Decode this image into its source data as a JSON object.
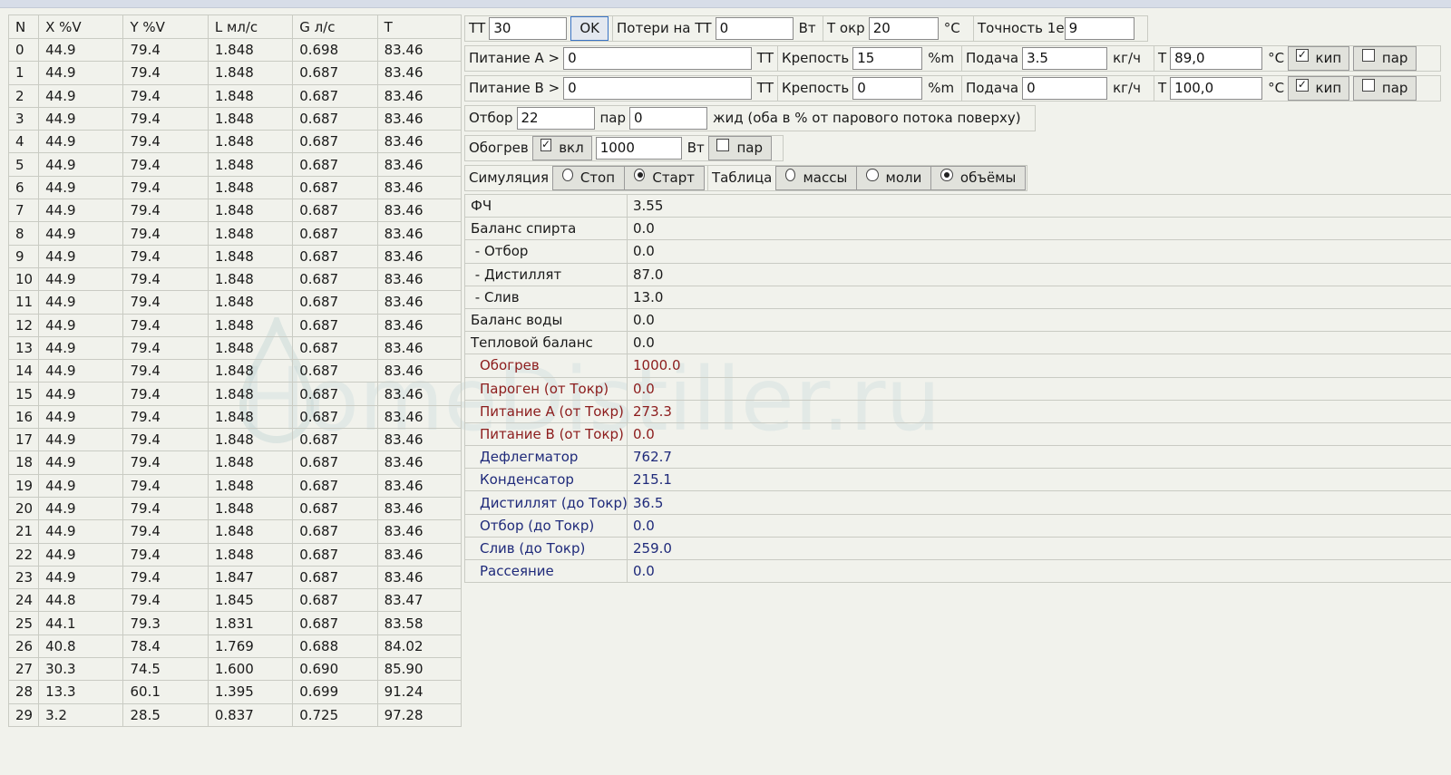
{
  "watermark": "HomeDistiller.ru",
  "stages": {
    "headers": [
      "N",
      "X %V",
      "Y %V",
      "L мл/с",
      "G л/с",
      "T"
    ],
    "rows": [
      [
        "0",
        "44.9",
        "79.4",
        "1.848",
        "0.698",
        "83.46"
      ],
      [
        "1",
        "44.9",
        "79.4",
        "1.848",
        "0.687",
        "83.46"
      ],
      [
        "2",
        "44.9",
        "79.4",
        "1.848",
        "0.687",
        "83.46"
      ],
      [
        "3",
        "44.9",
        "79.4",
        "1.848",
        "0.687",
        "83.46"
      ],
      [
        "4",
        "44.9",
        "79.4",
        "1.848",
        "0.687",
        "83.46"
      ],
      [
        "5",
        "44.9",
        "79.4",
        "1.848",
        "0.687",
        "83.46"
      ],
      [
        "6",
        "44.9",
        "79.4",
        "1.848",
        "0.687",
        "83.46"
      ],
      [
        "7",
        "44.9",
        "79.4",
        "1.848",
        "0.687",
        "83.46"
      ],
      [
        "8",
        "44.9",
        "79.4",
        "1.848",
        "0.687",
        "83.46"
      ],
      [
        "9",
        "44.9",
        "79.4",
        "1.848",
        "0.687",
        "83.46"
      ],
      [
        "10",
        "44.9",
        "79.4",
        "1.848",
        "0.687",
        "83.46"
      ],
      [
        "11",
        "44.9",
        "79.4",
        "1.848",
        "0.687",
        "83.46"
      ],
      [
        "12",
        "44.9",
        "79.4",
        "1.848",
        "0.687",
        "83.46"
      ],
      [
        "13",
        "44.9",
        "79.4",
        "1.848",
        "0.687",
        "83.46"
      ],
      [
        "14",
        "44.9",
        "79.4",
        "1.848",
        "0.687",
        "83.46"
      ],
      [
        "15",
        "44.9",
        "79.4",
        "1.848",
        "0.687",
        "83.46"
      ],
      [
        "16",
        "44.9",
        "79.4",
        "1.848",
        "0.687",
        "83.46"
      ],
      [
        "17",
        "44.9",
        "79.4",
        "1.848",
        "0.687",
        "83.46"
      ],
      [
        "18",
        "44.9",
        "79.4",
        "1.848",
        "0.687",
        "83.46"
      ],
      [
        "19",
        "44.9",
        "79.4",
        "1.848",
        "0.687",
        "83.46"
      ],
      [
        "20",
        "44.9",
        "79.4",
        "1.848",
        "0.687",
        "83.46"
      ],
      [
        "21",
        "44.9",
        "79.4",
        "1.848",
        "0.687",
        "83.46"
      ],
      [
        "22",
        "44.9",
        "79.4",
        "1.848",
        "0.687",
        "83.46"
      ],
      [
        "23",
        "44.9",
        "79.4",
        "1.847",
        "0.687",
        "83.46"
      ],
      [
        "24",
        "44.8",
        "79.4",
        "1.845",
        "0.687",
        "83.47"
      ],
      [
        "25",
        "44.1",
        "79.3",
        "1.831",
        "0.687",
        "83.58"
      ],
      [
        "26",
        "40.8",
        "78.4",
        "1.769",
        "0.688",
        "84.02"
      ],
      [
        "27",
        "30.3",
        "74.5",
        "1.600",
        "0.690",
        "85.90"
      ],
      [
        "28",
        "13.3",
        "60.1",
        "1.395",
        "0.699",
        "91.24"
      ],
      [
        "29",
        "3.2",
        "28.5",
        "0.837",
        "0.725",
        "97.28"
      ]
    ]
  },
  "controls": {
    "tt": {
      "label": "ТТ",
      "value": "30",
      "ok": "OK"
    },
    "losses": {
      "label": "Потери на ТТ",
      "value": "0",
      "unit": "Вт"
    },
    "tamb": {
      "label": "Т окр",
      "value": "20",
      "unit": "°C"
    },
    "precision": {
      "label": "Точность 1е",
      "value": "9"
    },
    "feedA": {
      "label": "Питание A >",
      "value": "0",
      "unit": "ТТ",
      "strength_label": "Крепость",
      "strength": "15",
      "strength_unit": "%m",
      "flow_label": "Подача",
      "flow": "3.5",
      "flow_unit": "кг/ч",
      "t_label": "Т",
      "t": "89,0",
      "t_unit": "°C",
      "boil_label": "кип",
      "boil_checked": true,
      "steam_label": "пар",
      "steam_checked": false
    },
    "feedB": {
      "label": "Питание B >",
      "value": "0",
      "unit": "ТТ",
      "strength_label": "Крепость",
      "strength": "0",
      "strength_unit": "%m",
      "flow_label": "Подача",
      "flow": "0",
      "flow_unit": "кг/ч",
      "t_label": "Т",
      "t": "100,0",
      "t_unit": "°C",
      "boil_label": "кип",
      "boil_checked": true,
      "steam_label": "пар",
      "steam_checked": false
    },
    "draw": {
      "label": "Отбор",
      "value": "22",
      "steam_label": "пар",
      "liquid": "0",
      "note": "жид (оба в % от парового потока поверху)"
    },
    "heat": {
      "label": "Обогрев",
      "on_label": "вкл",
      "on_checked": true,
      "value": "1000",
      "unit": "Вт",
      "steam_label": "пар",
      "steam_checked": false
    },
    "sim": {
      "label": "Симуляция",
      "stop": "Стоп",
      "start": "Старт",
      "selected": "start"
    },
    "table": {
      "label": "Таблица",
      "mass": "массы",
      "moles": "моли",
      "volumes": "объёмы",
      "selected": "volumes"
    }
  },
  "results": {
    "colors": {
      "red": "#8c1c1c",
      "blue": "#1f2a7a"
    },
    "rows": [
      {
        "label": "ФЧ",
        "value": "3.55",
        "style": "normal"
      },
      {
        "label": "Баланс спирта",
        "value": "0.0",
        "style": "normal"
      },
      {
        "label": " - Отбор",
        "value": "0.0",
        "style": "normal"
      },
      {
        "label": " - Дистиллят",
        "value": "87.0",
        "style": "normal"
      },
      {
        "label": " - Слив",
        "value": "13.0",
        "style": "normal"
      },
      {
        "label": "Баланс воды",
        "value": "0.0",
        "style": "normal"
      },
      {
        "label": "Тепловой баланс",
        "value": "0.0",
        "style": "normal"
      },
      {
        "label": "Обогрев",
        "value": "1000.0",
        "style": "red"
      },
      {
        "label": "Пароген (от Токр)",
        "value": "0.0",
        "style": "red"
      },
      {
        "label": "Питание A (от Токр)",
        "value": "273.3",
        "style": "red"
      },
      {
        "label": "Питание B (от Токр)",
        "value": "0.0",
        "style": "red"
      },
      {
        "label": "Дефлегматор",
        "value": "762.7",
        "style": "blue"
      },
      {
        "label": "Конденсатор",
        "value": "215.1",
        "style": "blue"
      },
      {
        "label": "Дистиллят (до Токр)",
        "value": "36.5",
        "style": "blue"
      },
      {
        "label": "Отбор (до Токр)",
        "value": "0.0",
        "style": "blue"
      },
      {
        "label": "Слив (до Токр)",
        "value": "259.0",
        "style": "blue"
      },
      {
        "label": "Рассеяние",
        "value": "0.0",
        "style": "blue"
      }
    ]
  }
}
